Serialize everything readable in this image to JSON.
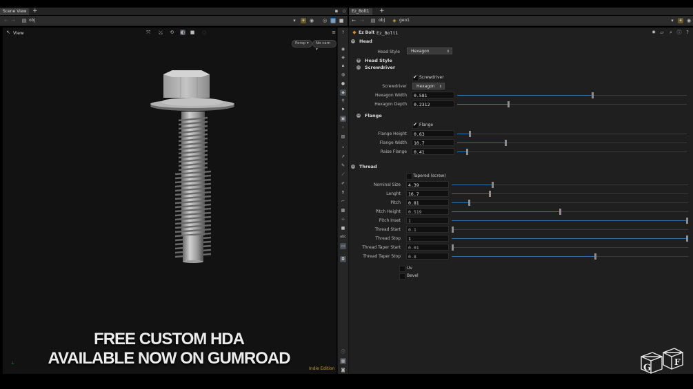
{
  "left_tabs": {
    "tab1": "Scene View"
  },
  "left_path": "obj",
  "viewport": {
    "title": "View",
    "persp": "Persp",
    "cam": "No cam",
    "edition": "Indie Edition",
    "promo_line1": "FREE CUSTOM HDA",
    "promo_line2": "AVAILABLE NOW ON GUMROAD"
  },
  "right_tabs": {
    "tab1": "Ez_Bolt1"
  },
  "right_path": {
    "p1": "obj",
    "p2": "geo1"
  },
  "node": {
    "type": "Ez Bolt",
    "name": "Ez_Bolt1"
  },
  "params": {
    "head_section": "Head",
    "head_style_label": "Head Style",
    "head_style_value": "Hexagon",
    "head_style_folder": "Head Style",
    "screwdriver_folder": "Screwdriver",
    "screwdriver_toggle": "Screwdriver",
    "screwdriver_label": "Screwdriver",
    "screwdriver_value": "Hexagon",
    "hex_width_label": "Hexagon Width",
    "hex_width": "0.581",
    "hex_depth_label": "Hexagon Depth",
    "hex_depth": "0.2312",
    "flange_folder": "Flange",
    "flange_toggle": "Flange",
    "flange_height_label": "Flange Height",
    "flange_height": "0.63",
    "flange_width_label": "Flange Width",
    "flange_width": "10.7",
    "raise_flange_label": "Raise Flange",
    "raise_flange": "0.41",
    "thread_section": "Thread",
    "tapered_label": "Tapered (screw)",
    "nominal_label": "Nominal Size",
    "nominal": "4.39",
    "length_label": "Lenght",
    "length": "16.7",
    "pitch_label": "Pitch",
    "pitch": "0.81",
    "pitch_height_label": "Pitch Height",
    "pitch_height": "0.519",
    "pitch_inset_label": "Pitch Inset",
    "pitch_inset": "1",
    "thread_start_label": "Thread Start",
    "thread_start": "0.1",
    "thread_stop_label": "Thread Stop",
    "thread_stop": "1",
    "taper_start_label": "Thread Taper Start",
    "taper_start": "0.01",
    "taper_stop_label": "Thread Taper Stop",
    "taper_stop": "0.8",
    "uv_label": "Uv",
    "bevel_label": "Bevel"
  },
  "sliders": {
    "hex_width": 0.59,
    "hex_depth": 0.22,
    "flange_height": 0.05,
    "flange_width": 0.21,
    "raise_flange": 0.04,
    "nominal": 0.17,
    "length": 0.16,
    "pitch": 0.07,
    "pitch_height": 0.46,
    "pitch_inset": 1.0,
    "thread_start": 0.0,
    "thread_stop": 1.0,
    "taper_start": 0.0,
    "taper_stop": 0.61
  },
  "logo": {
    "left": "G",
    "right": "F"
  }
}
